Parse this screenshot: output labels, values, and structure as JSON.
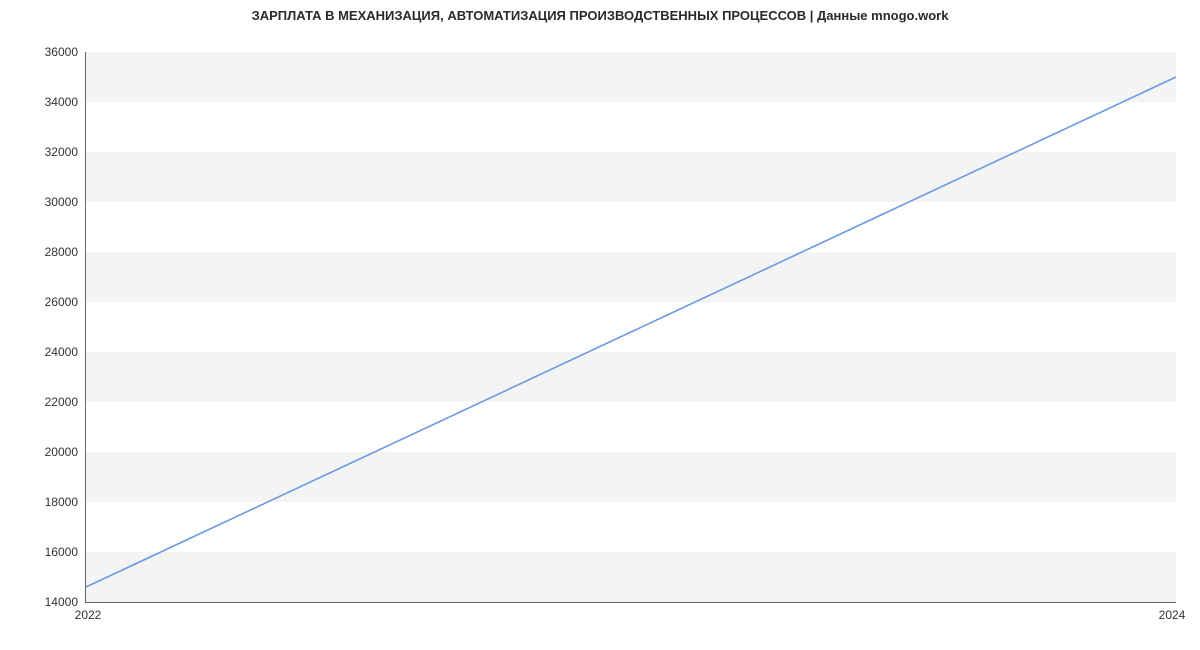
{
  "chart_data": {
    "type": "line",
    "title": "ЗАРПЛАТА В  МЕХАНИЗАЦИЯ, АВТОМАТИЗАЦИЯ ПРОИЗВОДСТВЕННЫХ ПРОЦЕССОВ | Данные mnogo.work",
    "xlabel": "",
    "ylabel": "",
    "x": [
      2022,
      2024
    ],
    "series": [
      {
        "name": "salary",
        "values": [
          14600,
          35000
        ]
      }
    ],
    "y_ticks": [
      14000,
      16000,
      18000,
      20000,
      22000,
      24000,
      26000,
      28000,
      30000,
      32000,
      34000,
      36000
    ],
    "x_ticks": [
      2022,
      2024
    ],
    "ylim": [
      14000,
      36000
    ],
    "xlim": [
      2022,
      2024
    ],
    "colors": {
      "line": "#6a9ae0",
      "band": "#f4f4f4"
    }
  }
}
